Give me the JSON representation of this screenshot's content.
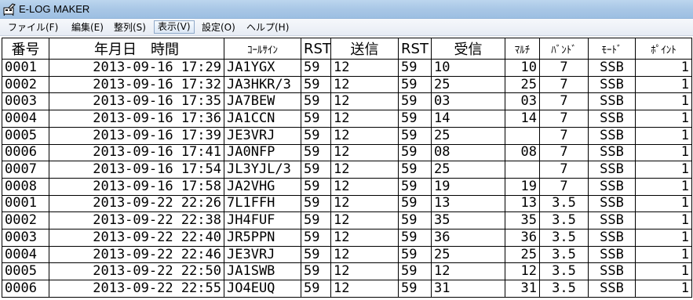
{
  "window": {
    "title": "E-LOG MAKER"
  },
  "menu": [
    {
      "label": "ファイル(F)"
    },
    {
      "label": "編集(E)"
    },
    {
      "label": "整列(S)"
    },
    {
      "label": "表示(V)"
    },
    {
      "label": "設定(O)"
    },
    {
      "label": "ヘルプ(H)"
    }
  ],
  "table": {
    "headers": [
      "番号",
      "年月日　時間",
      "ｺｰﾙｻｲﾝ",
      "RST",
      "送信",
      "RST",
      "受信",
      "ﾏﾙﾁ",
      "ﾊﾞﾝﾄﾞ",
      "ﾓｰﾄﾞ",
      "ﾎﾟｲﾝﾄ"
    ],
    "rows": [
      [
        "0001",
        "2013-09-16 17:29",
        "JA1YGX",
        "59",
        "12",
        "59",
        "10",
        "10",
        "7",
        "SSB",
        "1"
      ],
      [
        "0002",
        "2013-09-16 17:32",
        "JA3HKR/3",
        "59",
        "12",
        "59",
        "25",
        "25",
        "7",
        "SSB",
        "1"
      ],
      [
        "0003",
        "2013-09-16 17:35",
        "JA7BEW",
        "59",
        "12",
        "59",
        "03",
        "03",
        "7",
        "SSB",
        "1"
      ],
      [
        "0004",
        "2013-09-16 17:36",
        "JA1CCN",
        "59",
        "12",
        "59",
        "14",
        "14",
        "7",
        "SSB",
        "1"
      ],
      [
        "0005",
        "2013-09-16 17:39",
        "JE3VRJ",
        "59",
        "12",
        "59",
        "25",
        "",
        "7",
        "SSB",
        "1"
      ],
      [
        "0006",
        "2013-09-16 17:41",
        "JA0NFP",
        "59",
        "12",
        "59",
        "08",
        "08",
        "7",
        "SSB",
        "1"
      ],
      [
        "0007",
        "2013-09-16 17:54",
        "JL3YJL/3",
        "59",
        "12",
        "59",
        "25",
        "",
        "7",
        "SSB",
        "1"
      ],
      [
        "0008",
        "2013-09-16 17:58",
        "JA2VHG",
        "59",
        "12",
        "59",
        "19",
        "19",
        "7",
        "SSB",
        "1"
      ],
      [
        "0001",
        "2013-09-22 22:26",
        "7L1FFH",
        "59",
        "12",
        "59",
        "13",
        "13",
        "3.5",
        "SSB",
        "1"
      ],
      [
        "0002",
        "2013-09-22 22:38",
        "JH4FUF",
        "59",
        "12",
        "59",
        "35",
        "35",
        "3.5",
        "SSB",
        "1"
      ],
      [
        "0003",
        "2013-09-22 22:40",
        "JR5PPN",
        "59",
        "12",
        "59",
        "36",
        "36",
        "3.5",
        "SSB",
        "1"
      ],
      [
        "0004",
        "2013-09-22 22:46",
        "JE3VRJ",
        "59",
        "12",
        "59",
        "25",
        "25",
        "3.5",
        "SSB",
        "1"
      ],
      [
        "0005",
        "2013-09-22 22:50",
        "JA1SWB",
        "59",
        "12",
        "59",
        "12",
        "12",
        "3.5",
        "SSB",
        "1"
      ],
      [
        "0006",
        "2013-09-22 22:55",
        "JO4EUQ",
        "59",
        "12",
        "59",
        "31",
        "31",
        "3.5",
        "SSB",
        "1"
      ]
    ]
  }
}
